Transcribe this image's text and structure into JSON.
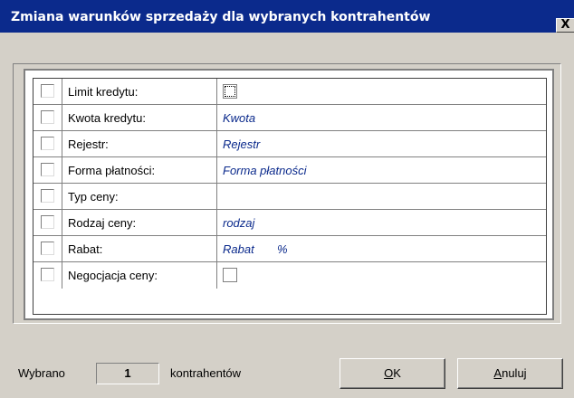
{
  "window": {
    "title": "Zmiana warunków sprzedaży dla wybranych kontrahentów",
    "close_glyph": "X"
  },
  "rows": [
    {
      "label": "Limit kredytu:",
      "value": "",
      "value_kind": "checkbox-focused"
    },
    {
      "label": "Kwota kredytu:",
      "value": "Kwota"
    },
    {
      "label": "Rejestr:",
      "value": "Rejestr"
    },
    {
      "label": "Forma płatności:",
      "value": "Forma płatności"
    },
    {
      "label": "Typ ceny:",
      "value": ""
    },
    {
      "label": "Rodzaj ceny:",
      "value": "rodzaj"
    },
    {
      "label": "Rabat:",
      "value": "Rabat",
      "suffix": "%"
    },
    {
      "label": "Negocjacja ceny:",
      "value": "",
      "value_kind": "checkbox"
    }
  ],
  "footer": {
    "selected_prefix": "Wybrano",
    "selected_count": "1",
    "selected_suffix": "kontrahentów",
    "ok_first": "O",
    "ok_rest": "K",
    "cancel_first": "A",
    "cancel_rest": "nuluj"
  },
  "colors": {
    "titlebar": "#0b2a8c",
    "dialog_bg": "#d4d0c8",
    "value_text": "#0b2a8c"
  }
}
